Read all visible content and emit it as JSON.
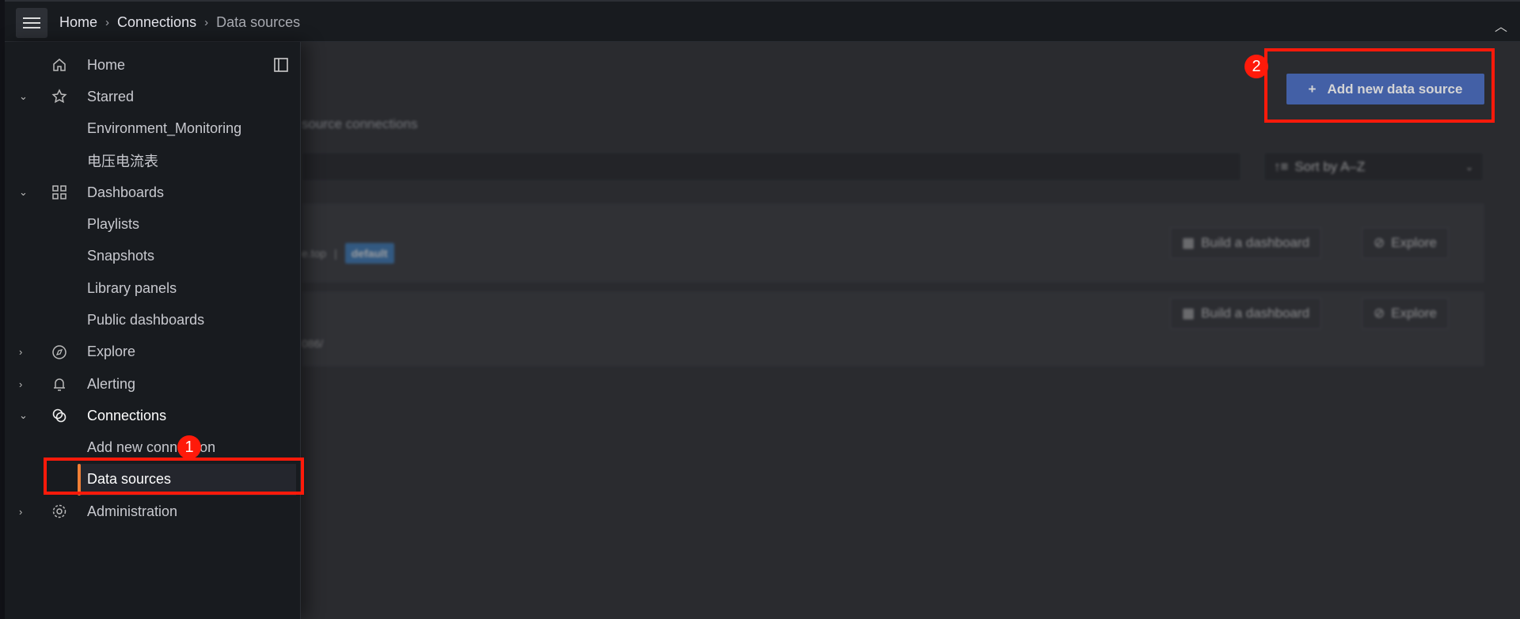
{
  "topbar": {
    "breadcrumbs": [
      "Home",
      "Connections",
      "Data sources"
    ]
  },
  "sidebar": {
    "items": [
      {
        "label": "Home",
        "icon": "home-icon"
      },
      {
        "label": "Starred",
        "icon": "star-icon",
        "expanded": true
      },
      {
        "label": "Environment_Monitoring"
      },
      {
        "label": "电压电流表"
      },
      {
        "label": "Dashboards",
        "icon": "apps-icon",
        "expanded": true
      },
      {
        "label": "Playlists"
      },
      {
        "label": "Snapshots"
      },
      {
        "label": "Library panels"
      },
      {
        "label": "Public dashboards"
      },
      {
        "label": "Explore",
        "icon": "compass-icon",
        "expanded": false
      },
      {
        "label": "Alerting",
        "icon": "bell-icon",
        "expanded": false
      },
      {
        "label": "Connections",
        "icon": "connections-icon",
        "expanded": true
      },
      {
        "label": "Add new connection"
      },
      {
        "label": "Data sources",
        "active": true
      },
      {
        "label": "Administration",
        "icon": "cog-icon",
        "expanded": false
      }
    ]
  },
  "main": {
    "subtitle_fragment": "source connections",
    "add_button": "Add new data source",
    "sort": "Sort by A–Z",
    "cards": [
      {
        "url_fragment": "e.top",
        "badge": "default",
        "build": "Build a dashboard",
        "explore": "Explore"
      },
      {
        "url_fragment": "086/",
        "build": "Build a dashboard",
        "explore": "Explore"
      }
    ]
  },
  "annotations": {
    "step1": "1",
    "step2": "2",
    "color": "#ff1a0a"
  },
  "colors": {
    "active_accent": "#f07f36",
    "primary": "#4a6ec4",
    "badge": "#3a7fc4"
  }
}
